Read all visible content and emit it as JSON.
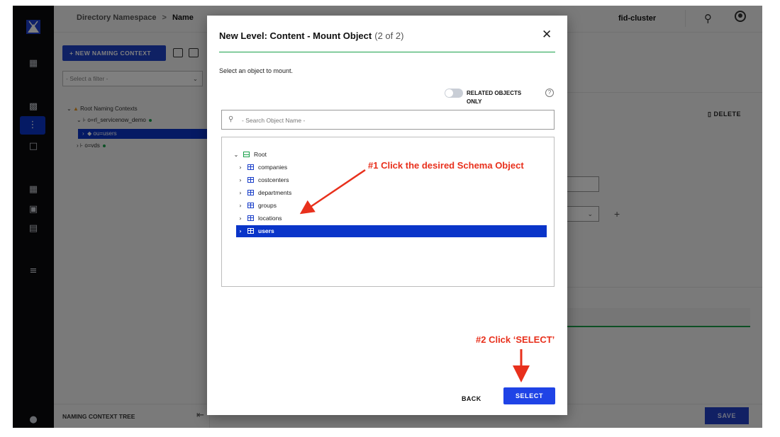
{
  "topbar": {
    "breadcrumb_root": "Directory Namespace",
    "breadcrumb_sep": ">",
    "breadcrumb_current": "Name",
    "cluster": "fid-cluster"
  },
  "panel": {
    "new_button": "+ NEW NAMING CONTEXT",
    "filter_placeholder": "- Select a filter -",
    "tree": {
      "root": "Root Naming Contexts",
      "child1": "o=rl_servicenow_demo",
      "child1_sub": "ou=users",
      "child2": "o=vds"
    },
    "footer": "NAMING CONTEXT TREE"
  },
  "content": {
    "delete_label": "DELETE",
    "save_label": "SAVE"
  },
  "modal": {
    "title": "New Level: Content - Mount Object",
    "step": "(2 of 2)",
    "instruction": "Select an object to mount.",
    "toggle_label": "RELATED OBJECTS ONLY",
    "search_placeholder": "- Search Object Name -",
    "tree_root": "Root",
    "objects": [
      "companies",
      "costcenters",
      "departments",
      "groups",
      "locations",
      "users"
    ],
    "selected": "users",
    "back_label": "BACK",
    "select_label": "SELECT"
  },
  "annotations": {
    "step1": "#1 Click the desired Schema Object",
    "step2": "#2 Click ‘SELECT’",
    "color": "#e8301c"
  },
  "colors": {
    "accent": "#1f43e6",
    "selection": "#0a35c9",
    "success": "#1aa14b",
    "rail": "#0b0b0d"
  },
  "icons": [
    "logo-icon",
    "dashboard-icon",
    "directory-icon",
    "namespace-icon",
    "import-icon",
    "table-icon",
    "lock-icon",
    "certificate-icon",
    "list-icon",
    "users-icon",
    "search-icon",
    "user-profile-icon",
    "close-icon",
    "help-icon"
  ]
}
